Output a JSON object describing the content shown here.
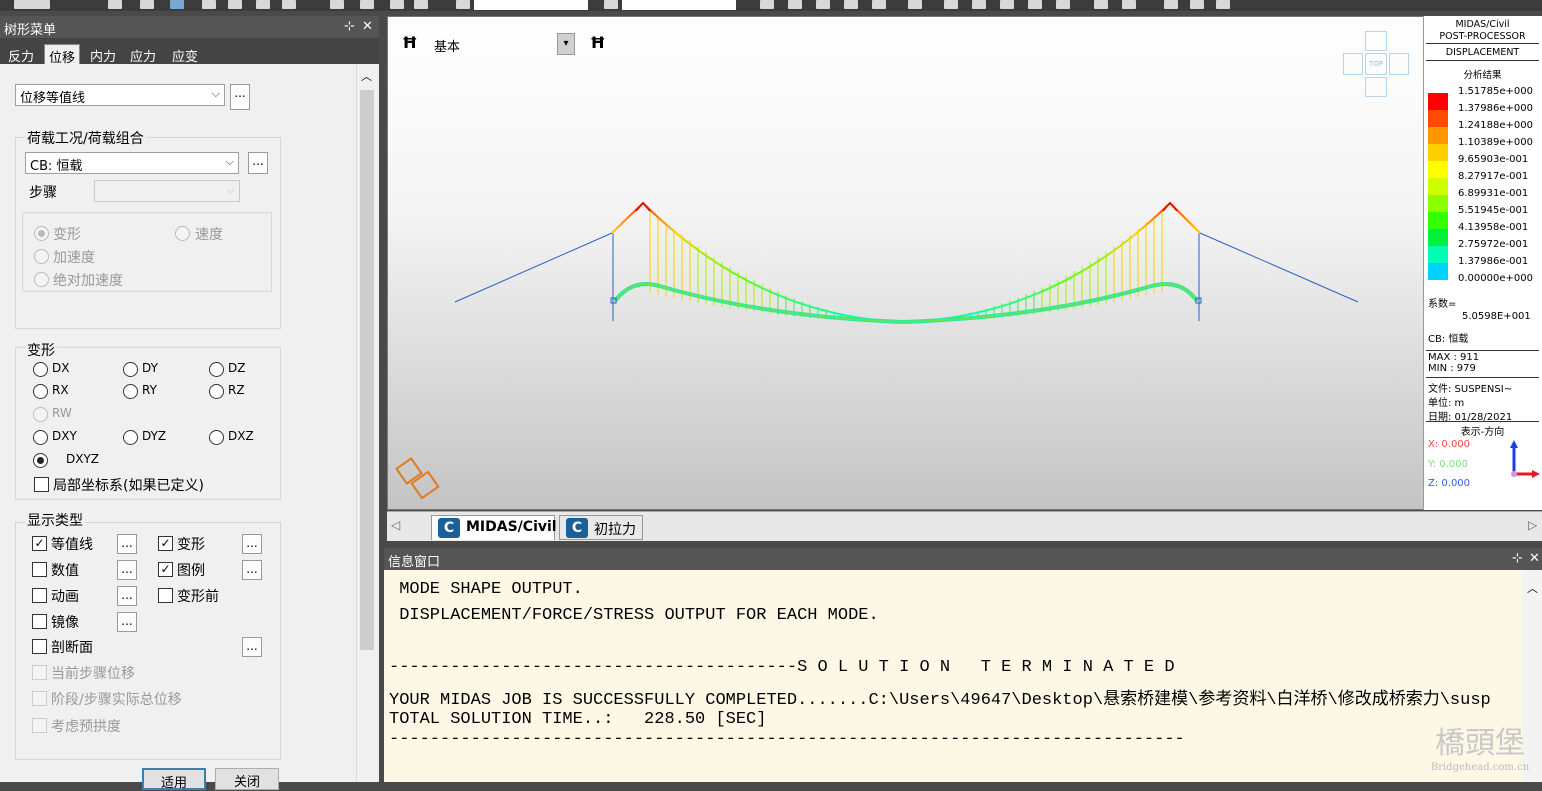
{
  "tree_panel": {
    "title": "树形菜单",
    "pin": "⊹",
    "close": "✕",
    "tabs": [
      "反力",
      "位移",
      "内力",
      "应力",
      "应变"
    ],
    "active_tab": "位移",
    "mode_select": "位移等值线",
    "ellipsis": "...",
    "load_group_label": "荷载工况/荷载组合",
    "load_case_value": "CB: 恒载",
    "step_label": "步骤",
    "step_value": "",
    "motion": {
      "deform": "变形",
      "velocity": "速度",
      "accel": "加速度",
      "abs_accel": "绝对加速度"
    },
    "deform_group_label": "变形",
    "components": [
      "DX",
      "DY",
      "DZ",
      "RX",
      "RY",
      "RZ",
      "RW",
      "DXY",
      "DYZ",
      "DXZ",
      "DXYZ"
    ],
    "local_axis": "局部坐标系(如果已定义)",
    "display_group_label": "显示类型",
    "display": {
      "contour": "等值线",
      "deformed": "变形",
      "values": "数值",
      "legend": "图例",
      "animate": "动画",
      "undeformed": "变形前",
      "mirror": "镜像",
      "section": "剖断面",
      "cur_step": "当前步骤位移",
      "stage_total": "阶段/步骤实际总位移",
      "camber": "考虑预拱度"
    },
    "apply_button": "适用",
    "close_button": "关闭"
  },
  "view": {
    "view_name": "基本",
    "navcube_top": "TOP"
  },
  "legend": {
    "app": "MIDAS/Civil",
    "module": "POST-PROCESSOR",
    "result_type": "DISPLACEMENT",
    "analysis_label": "分析结果",
    "values": [
      "1.51785e+000",
      "1.37986e+000",
      "1.24188e+000",
      "1.10389e+000",
      "9.65903e-001",
      "8.27917e-001",
      "6.89931e-001",
      "5.51945e-001",
      "4.13958e-001",
      "2.75972e-001",
      "1.37986e-001",
      "0.00000e+000"
    ],
    "colors": [
      "#ff0000",
      "#ff4a00",
      "#ff9600",
      "#ffd000",
      "#ffff00",
      "#ccff00",
      "#8cff00",
      "#33ff00",
      "#00f03c",
      "#00ffb4",
      "#00d2ff",
      "#0064ff"
    ],
    "factor_label": "系数=",
    "factor_value": "5.0598E+001",
    "load_case": "CB: 恒载",
    "max": "MAX : 911",
    "min": "MIN : 979",
    "file": "文件: SUSPENSI~",
    "unit": "单位: m",
    "date": "日期: 01/28/2021",
    "direction_label": "表示-方向",
    "x": "X: 0.000",
    "y": "Y: 0.000",
    "z": "Z: 0.000"
  },
  "doc_tabs": [
    {
      "label": "MIDAS/Civil",
      "active": true
    },
    {
      "label": "初拉力",
      "active": false
    }
  ],
  "message_window": {
    "title": "信息窗口",
    "lines": [
      " MODE SHAPE OUTPUT.",
      " DISPLACEMENT/FORCE/STRESS OUTPUT FOR EACH MODE.",
      "",
      "----------------------------------------S O L U T I O N   T E R M I N A T E D",
      "YOUR MIDAS JOB IS SUCCESSFULLY COMPLETED.......C:\\Users\\49647\\Desktop\\悬索桥建模\\参考资料\\白洋桥\\修改成桥索力\\susp",
      "TOTAL SOLUTION TIME..:   228.50 [SEC]",
      "------------------------------------------------------------------------------"
    ]
  },
  "watermark": {
    "text": "橋頭堡",
    "url": "Bridgehead.com.cn"
  },
  "colors": {
    "panel_title": "#555555",
    "message_bg": "#fdf8e6",
    "accent": "#3c7fb1"
  }
}
